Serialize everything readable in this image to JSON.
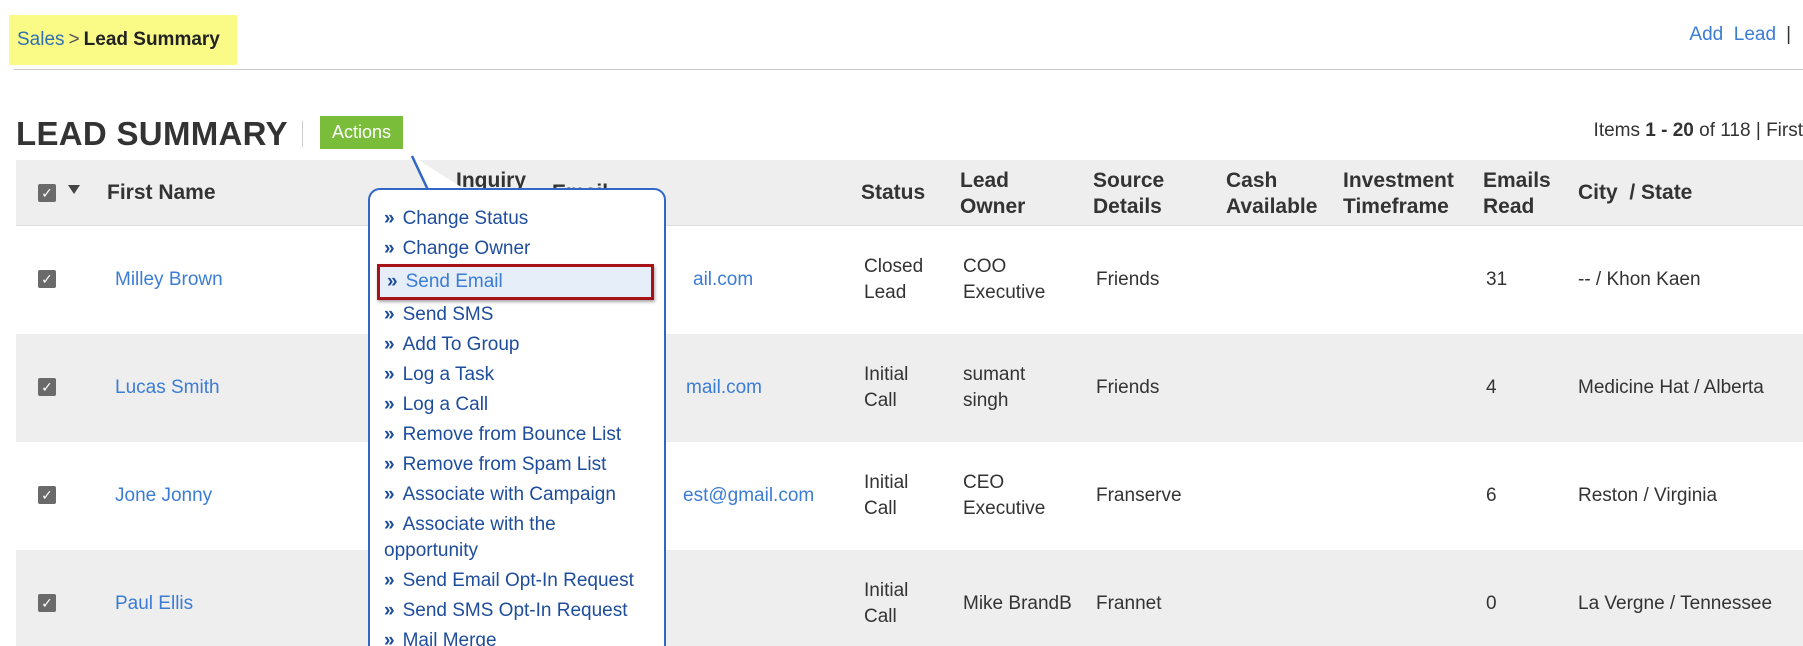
{
  "breadcrumb": {
    "parent": "Sales",
    "separator": ">",
    "current": "Lead Summary"
  },
  "top_right": {
    "add_lead": "Add  Lead",
    "divider": "|"
  },
  "page": {
    "title": "LEAD SUMMARY",
    "actions_label": "Actions"
  },
  "pager": {
    "prefix": "Items ",
    "range": "1 - 20",
    "of": " of 118 | ",
    "first": "First"
  },
  "columns": {
    "first_name": "First Name",
    "inquiry": "Inquiry",
    "email_partial": "Email",
    "status": "Status",
    "lead_owner_1": "Lead",
    "lead_owner_2": "Owner",
    "source_1": "Source",
    "source_2": "Details",
    "cash_1": "Cash",
    "cash_2": "Available",
    "invest_1": "Investment",
    "invest_2": "Timeframe",
    "emails_1": "Emails",
    "emails_2": "Read",
    "city_state": "City  / State"
  },
  "rows": [
    {
      "name": "Milley Brown",
      "email_visible": "ail.com",
      "status_1": "Closed",
      "status_2": "Lead",
      "owner_1": "COO",
      "owner_2": "Executive",
      "source": "Friends",
      "emails_read": "31",
      "city_state": "-- / Khon Kaen"
    },
    {
      "name": "Lucas Smith",
      "email_visible": "mail.com",
      "status_1": "Initial",
      "status_2": "Call",
      "owner_1": "sumant",
      "owner_2": "singh",
      "source": "Friends",
      "emails_read": "4",
      "city_state": "Medicine Hat / Alberta"
    },
    {
      "name": "Jone Jonny",
      "email_visible": "est@gmail.com",
      "status_1": "Initial",
      "status_2": "Call",
      "owner_1": "CEO",
      "owner_2": "Executive",
      "source": "Franserve",
      "emails_read": "6",
      "city_state": "Reston / Virginia"
    },
    {
      "name": "Paul Ellis",
      "email_visible": "",
      "status_1": "Initial",
      "status_2": "Call",
      "owner": "Mike BrandB",
      "source": "Frannet",
      "emails_read": "0",
      "city_state": "La Vergne / Tennessee"
    }
  ],
  "actions_menu": {
    "arrow": "»",
    "items": [
      "Change Status",
      "Change Owner",
      "Send Email",
      "Send SMS",
      "Add To Group",
      "Log a Task",
      "Log a Call",
      "Remove from Bounce List",
      "Remove from Spam List",
      "Associate with Campaign",
      "Associate with the",
      "opportunity",
      "Send Email Opt-In Request",
      "Send SMS Opt-In Request",
      "Mail Merge"
    ],
    "highlighted": "Send Email"
  },
  "colors": {
    "link": "#3b7cd4",
    "actions_green": "#79bd3b",
    "breadcrumb_highlight": "#fafa87",
    "menu_border": "#2f67c6",
    "highlight_border": "#a8131a"
  },
  "checkbox_mark": "✓"
}
